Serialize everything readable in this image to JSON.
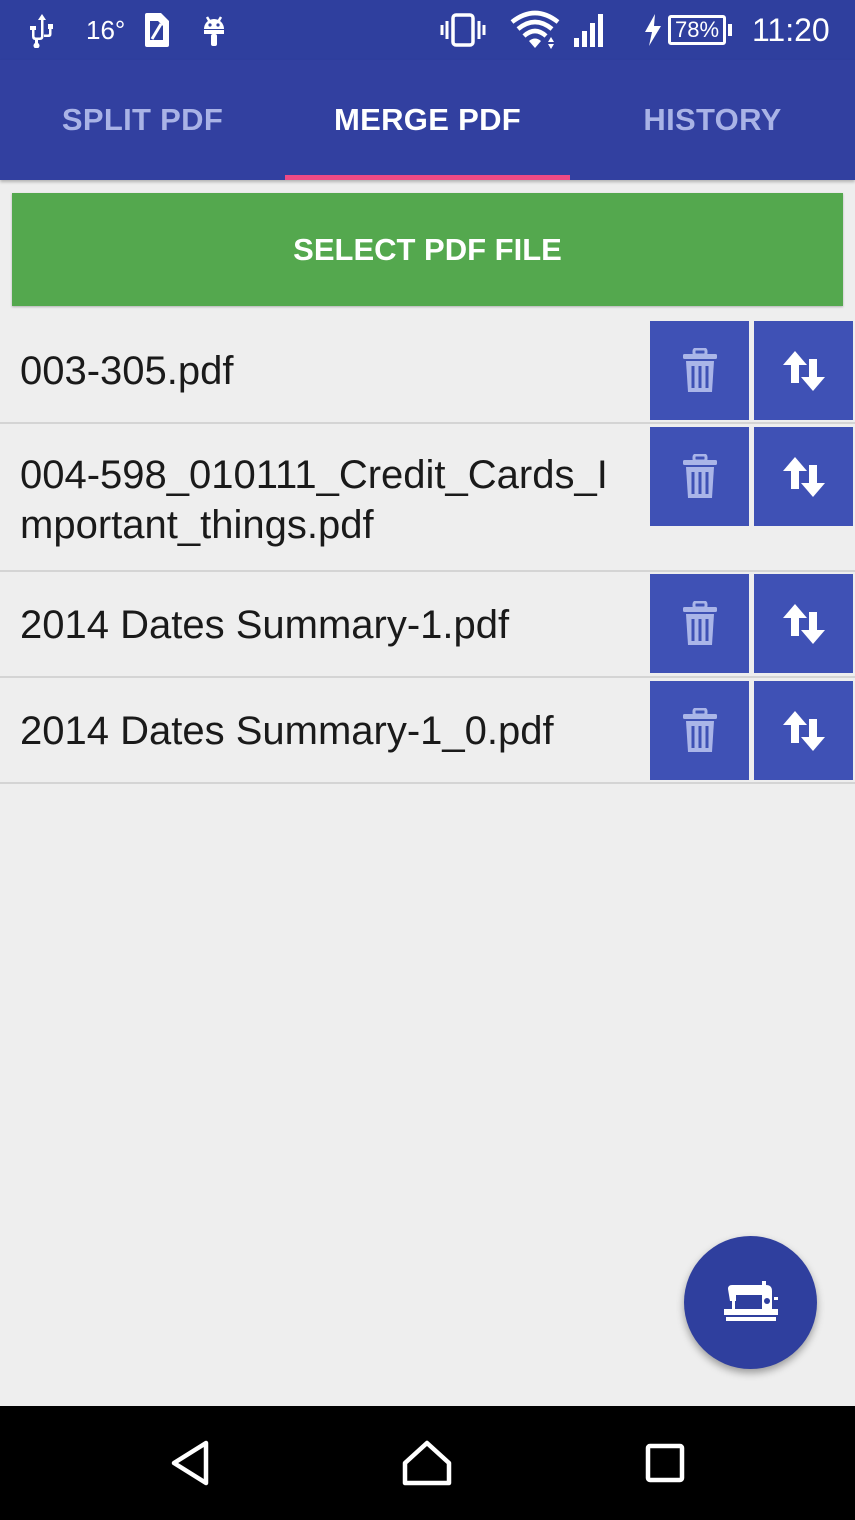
{
  "status_bar": {
    "icons": [
      "usb-icon",
      "weather-icon",
      "sim-icon",
      "android-icon",
      "vibrate-icon",
      "wifi-icon",
      "signal-icon",
      "charging-icon"
    ],
    "temperature": "16°",
    "battery_percent": "78%",
    "time": "11:20"
  },
  "tabs": [
    {
      "label": "SPLIT PDF",
      "active": false
    },
    {
      "label": "MERGE PDF",
      "active": true
    },
    {
      "label": "HISTORY",
      "active": false
    }
  ],
  "select_button": {
    "label": "SELECT PDF FILE"
  },
  "files": [
    {
      "name": "003-305.pdf"
    },
    {
      "name": "004-598_010111_Credit_Cards_Important_things.pdf"
    },
    {
      "name": "2014 Dates Summary-1.pdf"
    },
    {
      "name": "2014 Dates Summary-1_0.pdf"
    }
  ],
  "row_actions": {
    "delete_icon": "trash-icon",
    "reorder_icon": "swap-vertical-icon"
  },
  "fab": {
    "icon": "sewing-machine-icon"
  },
  "nav": {
    "back_icon": "back-icon",
    "home_icon": "home-icon",
    "recents_icon": "recents-icon"
  },
  "colors": {
    "primary": "#3240a0",
    "primary_dark": "#2f3f9e",
    "tab_indicator": "#ee4a85",
    "select_button": "#54a84e",
    "action_button": "#3f51b5"
  }
}
